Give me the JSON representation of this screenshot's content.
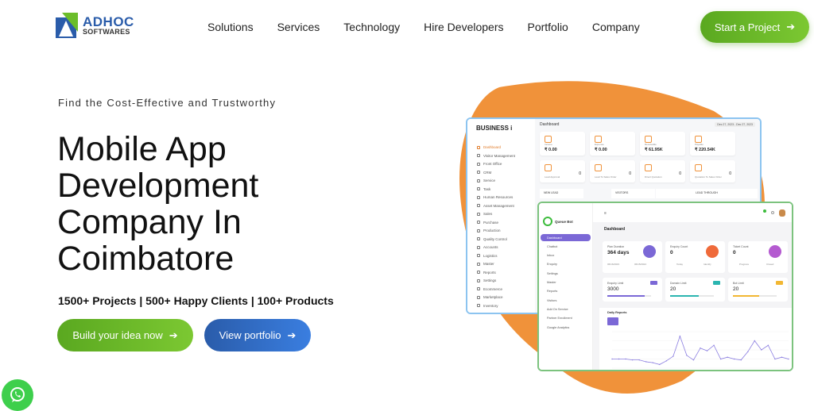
{
  "brand": {
    "name": "ADHOC",
    "sub": "SOFTWARES"
  },
  "nav": [
    "Solutions",
    "Services",
    "Technology",
    "Hire Developers",
    "Portfolio",
    "Company"
  ],
  "cta": {
    "label": "Start a Project",
    "icon": "arrow-right"
  },
  "hero": {
    "kicker": "Find the Cost-Effective and Trustworthy",
    "title": "Mobile App Development Company In Coimbatore",
    "stats": "1500+ Projects | 500+ Happy Clients | 100+ Products",
    "primary_btn": "Build your idea now",
    "secondary_btn": "View portfolio"
  },
  "colors": {
    "green": "#6bbd2a",
    "blue": "#2f6fd0",
    "orange": "#f0923a",
    "purple": "#7b68d6"
  },
  "mock1": {
    "brand": "BUSINESS i",
    "header": "Dashboard",
    "date_range": "Dec 27, 2023 - Dec 27, 2023",
    "sidebar": [
      "Dashboard",
      "Visitor Management",
      "Front Office",
      "CRM",
      "Service",
      "Task",
      "Human Resources",
      "Asset Management",
      "Sales",
      "Purchase",
      "Production",
      "Quality Control",
      "Accounts",
      "Logistics",
      "Master",
      "Reports",
      "Settings",
      "Ecommerce",
      "Marketplace",
      "Inventory"
    ],
    "cards": [
      {
        "label": "Income",
        "value": "₹ 0.00"
      },
      {
        "label": "Expense",
        "value": "₹ 0.00"
      },
      {
        "label": "Receivable",
        "value": "₹ 61.95K"
      },
      {
        "label": "Payable",
        "value": "₹ 220.54K"
      }
    ],
    "counts": [
      {
        "label": "Lead Approval",
        "value": "0"
      },
      {
        "label": "Lead To Sales Order",
        "value": "0"
      },
      {
        "label": "Direct Quotation",
        "value": "0"
      },
      {
        "label": "Quotation To Sales Order",
        "value": "0"
      }
    ],
    "row3": [
      "NEW LEAD",
      "VISITORS",
      "LEAD THROUGH"
    ]
  },
  "mock2": {
    "brand": "Queue Bot",
    "header": "Dashboard",
    "sidebar": [
      "Dashboard",
      "Chatbot",
      "Inbox",
      "Enquiry",
      "Settings",
      "Master",
      "Reports",
      "Visitors",
      "Add On Service",
      "Partner Enrollment",
      "Google Analytics"
    ],
    "plan": {
      "title": "Plan Duration",
      "value": "364 days",
      "start_label": "Start",
      "start": "06/16/2023",
      "expiry_label": "Expiry",
      "expiry": "06/15/2024"
    },
    "enquiry": {
      "title": "Enquiry Count",
      "value": "0",
      "a_label": "Today",
      "a": "0",
      "b_label": "Identify",
      "b": "0"
    },
    "ticket": {
      "title": "Ticket Count",
      "value": "0",
      "a_label": "Progress",
      "a": "0",
      "b_label": "Closed",
      "b": "0"
    },
    "limits": [
      {
        "title": "Enquiry Limit",
        "value": "3000",
        "fill": 0.85,
        "color": "#7b68d6"
      },
      {
        "title": "Domain Limit",
        "value": "20",
        "fill": 0.65,
        "color": "#2bb5b0"
      },
      {
        "title": "Bot Limit",
        "value": "20",
        "fill": 0.6,
        "color": "#f2b733"
      }
    ],
    "daily": {
      "title": "Daily Reports",
      "series": [
        10,
        10,
        10,
        9,
        9,
        7,
        6,
        4,
        8,
        13,
        35,
        14,
        9,
        22,
        19,
        25,
        10,
        12,
        10,
        9,
        18,
        30,
        20,
        25,
        10,
        12,
        10
      ]
    }
  }
}
